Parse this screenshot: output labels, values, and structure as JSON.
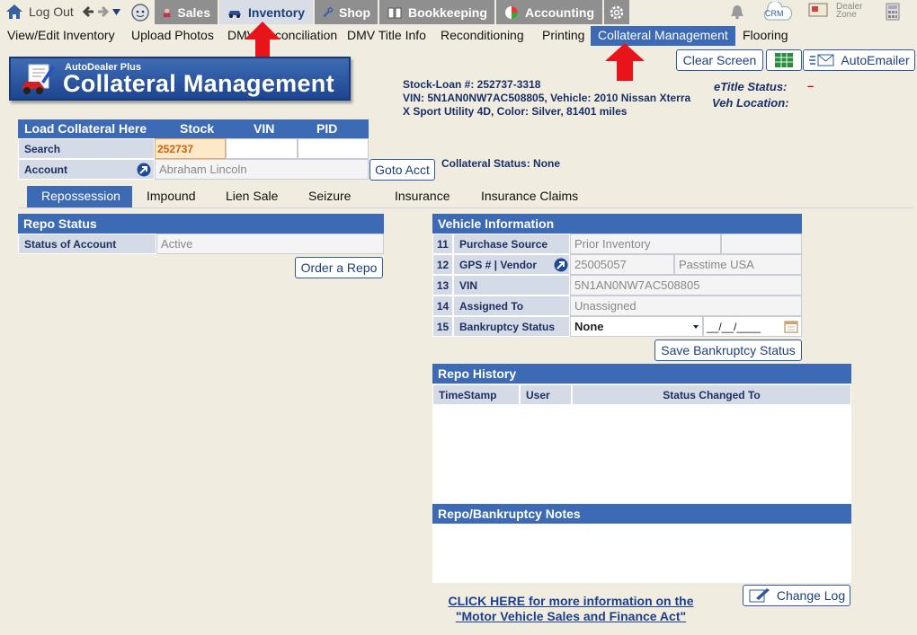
{
  "topnav": {
    "logout": "Log Out",
    "items": [
      {
        "label": "Sales",
        "icon": "person-icon"
      },
      {
        "label": "Inventory",
        "icon": "car-icon"
      },
      {
        "label": "Shop",
        "icon": "wrench-icon"
      },
      {
        "label": "Bookkeeping",
        "icon": "book-icon"
      },
      {
        "label": "Accounting",
        "icon": "pie-chart-icon"
      }
    ],
    "crm": "CRM",
    "dealer_zone": "Dealer Zone"
  },
  "subnav": [
    "View/Edit Inventory",
    "Upload Photos",
    "DMV Reconciliation",
    "DMV Title Info",
    "Reconditioning",
    "Printing",
    "Collateral Management",
    "Flooring"
  ],
  "actions": {
    "clear": "Clear Screen",
    "autoemailer": "AutoEmailer"
  },
  "logo": {
    "small": "AutoDealer Plus",
    "big": "Collateral Management"
  },
  "vehicle_summary": {
    "stock_loan": "Stock-Loan #:  252737-3318",
    "line2": "VIN:  5N1AN0NW7AC508805, Vehicle:  2010 Nissan Xterra",
    "line3": "X Sport Utility 4D, Color: Silver, 81401 miles",
    "etitle_label": "eTitle Status:",
    "etitle_value": "–",
    "location_label": "Veh Location:"
  },
  "load": {
    "header": "Load Collateral Here",
    "cols": [
      "Stock",
      "VIN",
      "PID"
    ],
    "search_label": "Search",
    "account_label": "Account",
    "stock_value": "252737",
    "account_value": "Abraham Lincoln",
    "goto": "Goto Acct",
    "collateral_status": "Collateral Status: None"
  },
  "tabs": [
    "Repossession",
    "Impound",
    "Lien Sale",
    "Seizure",
    "Insurance",
    "Insurance Claims"
  ],
  "repo_status": {
    "header": "Repo Status",
    "label": "Status of Account",
    "value": "Active",
    "order_button": "Order a Repo"
  },
  "vehicle_info": {
    "header": "Vehicle Information",
    "rows": [
      {
        "num": "11",
        "label": "Purchase Source",
        "value": "Prior Inventory"
      },
      {
        "num": "12",
        "label": "GPS # | Vendor",
        "value": "25005057",
        "value2": "Passtime  USA"
      },
      {
        "num": "13",
        "label": "VIN",
        "value": "5N1AN0NW7AC508805"
      },
      {
        "num": "14",
        "label": "Assigned To",
        "value": "Unassigned"
      },
      {
        "num": "15",
        "label": "Bankruptcy Status",
        "value": "None",
        "date": "__/__/____"
      }
    ],
    "save_button": "Save Bankruptcy Status"
  },
  "repo_history": {
    "header": "Repo History",
    "cols": [
      "TimeStamp",
      "User",
      "Status Changed To"
    ]
  },
  "notes": {
    "header": "Repo/Bankruptcy Notes"
  },
  "footer": {
    "link1": "CLICK HERE for more information on the",
    "link2": "\"Motor Vehicle Sales and Finance Act\"",
    "change_log": "Change Log"
  }
}
